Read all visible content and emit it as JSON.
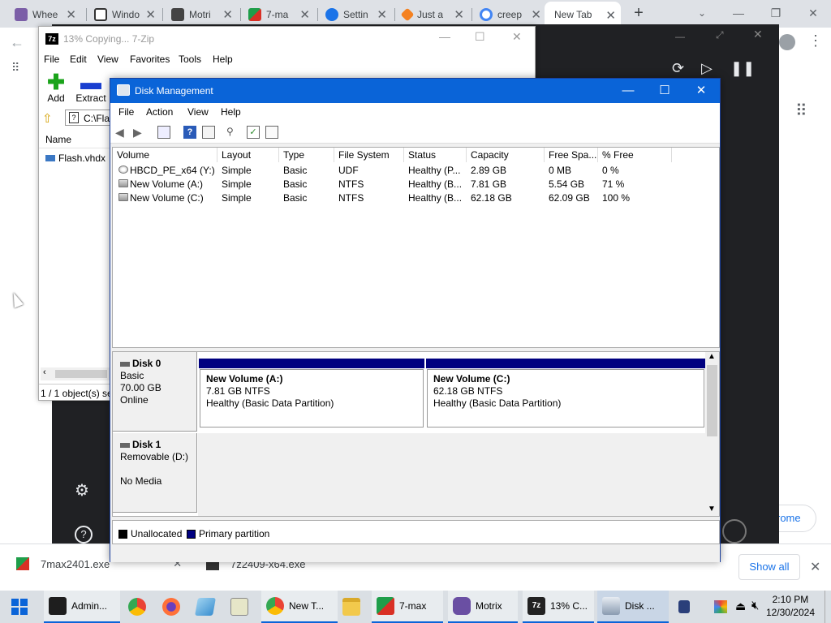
{
  "chrome": {
    "tabs": [
      {
        "label": "Whee",
        "color": "#7b5ea7"
      },
      {
        "label": "Windo",
        "color": "#333333"
      },
      {
        "label": "Motri",
        "color": "#444444"
      },
      {
        "label": "7-ma",
        "color": "#1f9e4a"
      },
      {
        "label": "Settin",
        "color": "#1a73e8"
      },
      {
        "label": "Just a",
        "color": "#f48120"
      },
      {
        "label": "creep",
        "color": "#4285f4"
      },
      {
        "label": "New Tab",
        "color": "#ffffff"
      }
    ],
    "new_tab_symbol": "+",
    "downloads": [
      {
        "name": "7max2401.exe"
      },
      {
        "name": "7z2409-x64.exe"
      }
    ],
    "show_all": "Show all",
    "chrome_promo": "rome"
  },
  "zip": {
    "title": "13% Copying... 7-Zip",
    "menu": [
      "File",
      "Edit",
      "View",
      "Favorites",
      "Tools",
      "Help"
    ],
    "toolbar": {
      "add": "Add",
      "extract": "Extract"
    },
    "path": "C:\\Fla",
    "column_name": "Name",
    "file": "Flash.vhdx",
    "status": "1 / 1 object(s) se"
  },
  "dm": {
    "title": "Disk Management",
    "menu": [
      "File",
      "Action",
      "View",
      "Help"
    ],
    "columns": [
      "Volume",
      "Layout",
      "Type",
      "File System",
      "Status",
      "Capacity",
      "Free Spa...",
      "% Free"
    ],
    "volumes": [
      {
        "volume": "HBCD_PE_x64 (Y:)",
        "layout": "Simple",
        "type": "Basic",
        "fs": "UDF",
        "status": "Healthy (P...",
        "capacity": "2.89 GB",
        "free": "0 MB",
        "pct": "0 %"
      },
      {
        "volume": "New Volume (A:)",
        "layout": "Simple",
        "type": "Basic",
        "fs": "NTFS",
        "status": "Healthy (B...",
        "capacity": "7.81 GB",
        "free": "5.54 GB",
        "pct": "71 %"
      },
      {
        "volume": "New Volume (C:)",
        "layout": "Simple",
        "type": "Basic",
        "fs": "NTFS",
        "status": "Healthy (B...",
        "capacity": "62.18 GB",
        "free": "62.09 GB",
        "pct": "100 %"
      }
    ],
    "disks": [
      {
        "name": "Disk 0",
        "type": "Basic",
        "size": "70.00 GB",
        "state": "Online"
      },
      {
        "name": "Disk 1",
        "type": "Removable (D:)",
        "size": "",
        "state": "No Media"
      }
    ],
    "partitions": [
      {
        "name": "New Volume  (A:)",
        "size": "7.81 GB NTFS",
        "status": "Healthy (Basic Data Partition)"
      },
      {
        "name": "New Volume  (C:)",
        "size": "62.18 GB NTFS",
        "status": "Healthy (Basic Data Partition)"
      }
    ],
    "legend": {
      "unallocated": "Unallocated",
      "primary": "Primary partition"
    },
    "colors": {
      "primary": "#000080",
      "unallocated": "#000000",
      "titlebar": "#0a64d8"
    }
  },
  "taskbar": {
    "apps": [
      {
        "label": "Admin...",
        "color": "#1e1e1e"
      },
      {
        "label": "New T...",
        "color": "#4285f4"
      },
      {
        "label": "7-max",
        "color": "#1f9e4a"
      },
      {
        "label": "Motrix",
        "color": "#6a4fa3"
      },
      {
        "label": "13% C...",
        "color": "#222222"
      },
      {
        "label": "Disk ...",
        "color": "#8a9bb0"
      }
    ],
    "time": "2:10 PM",
    "date": "12/30/2024"
  }
}
